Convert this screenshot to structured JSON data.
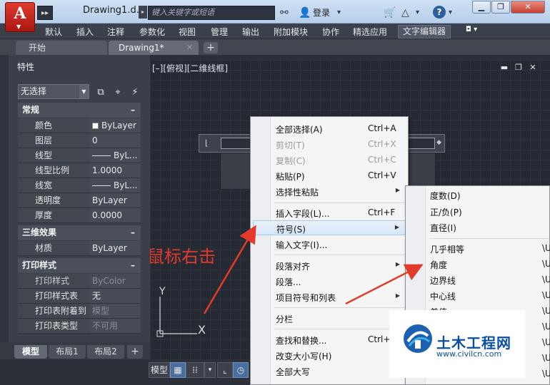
{
  "titlebar": {
    "app_letter": "A",
    "qat_expand": "▸▸",
    "doc_title": "Drawing1.d...",
    "search_placeholder": "键入关键字或短语",
    "login": "登录"
  },
  "ribbon": {
    "tabs": [
      "默认",
      "插入",
      "注释",
      "参数化",
      "视图",
      "管理",
      "输出",
      "附加模块",
      "协作",
      "精选应用",
      "文字编辑器"
    ]
  },
  "doctabs": {
    "tabs": [
      "开始",
      "Drawing1*"
    ],
    "add": "+"
  },
  "palette": {
    "title": "特性",
    "selection": "无选择",
    "sections": [
      {
        "name": "常规",
        "rows": [
          {
            "key": "颜色",
            "value": "ByLayer"
          },
          {
            "key": "图层",
            "value": "0"
          },
          {
            "key": "线型",
            "value": "ByL..."
          },
          {
            "key": "线型比例",
            "value": "1.0000"
          },
          {
            "key": "线宽",
            "value": "ByL..."
          },
          {
            "key": "透明度",
            "value": "ByLayer"
          },
          {
            "key": "厚度",
            "value": "0.0000"
          }
        ]
      },
      {
        "name": "三维效果",
        "rows": [
          {
            "key": "材质",
            "value": "ByLayer"
          }
        ]
      },
      {
        "name": "打印样式",
        "rows": [
          {
            "key": "打印样式",
            "value": "ByColor"
          },
          {
            "key": "打印样式表",
            "value": "无"
          },
          {
            "key": "打印表附着到",
            "value": "模型"
          },
          {
            "key": "打印表类型",
            "value": "不可用"
          }
        ]
      }
    ],
    "collapse": "–"
  },
  "viewport": {
    "label": "[–][俯视][二维线框]",
    "ucs_y": "Y",
    "ucs_x": "X"
  },
  "annotation": "鼠标右击",
  "layout_tabs": [
    "模型",
    "布局1",
    "布局2"
  ],
  "status": {
    "model": "模型"
  },
  "context_menu": {
    "items": [
      {
        "label": "全部选择(A)",
        "shortcut": "Ctrl+A"
      },
      {
        "label": "剪切(T)",
        "shortcut": "Ctrl+X",
        "disabled": true
      },
      {
        "label": "复制(C)",
        "shortcut": "Ctrl+C",
        "disabled": true
      },
      {
        "label": "粘贴(P)",
        "shortcut": "Ctrl+V"
      },
      {
        "label": "选择性粘贴",
        "shortcut": ""
      },
      {
        "label": "插入字段(L)...",
        "shortcut": "Ctrl+F"
      },
      {
        "label": "符号(S)",
        "shortcut": ""
      },
      {
        "label": "输入文字(I)...",
        "shortcut": ""
      },
      {
        "label": "段落对齐",
        "shortcut": ""
      },
      {
        "label": "段落...",
        "shortcut": ""
      },
      {
        "label": "项目符号和列表",
        "shortcut": ""
      },
      {
        "label": "分栏",
        "shortcut": ""
      },
      {
        "label": "查找和替换...",
        "shortcut": "Ctrl+"
      },
      {
        "label": "改变大小写(H)",
        "shortcut": ""
      },
      {
        "label": "全部大写",
        "shortcut": ""
      }
    ]
  },
  "symbol_submenu": {
    "items": [
      "度数(D)",
      "正/负(P)",
      "直径(I)",
      "几乎相等",
      "角度",
      "边界线",
      "中心线",
      "差值"
    ],
    "shortcut_stub": "\\U"
  },
  "watermark": {
    "title": "土木工程网",
    "url": "www.civilcn.com"
  }
}
